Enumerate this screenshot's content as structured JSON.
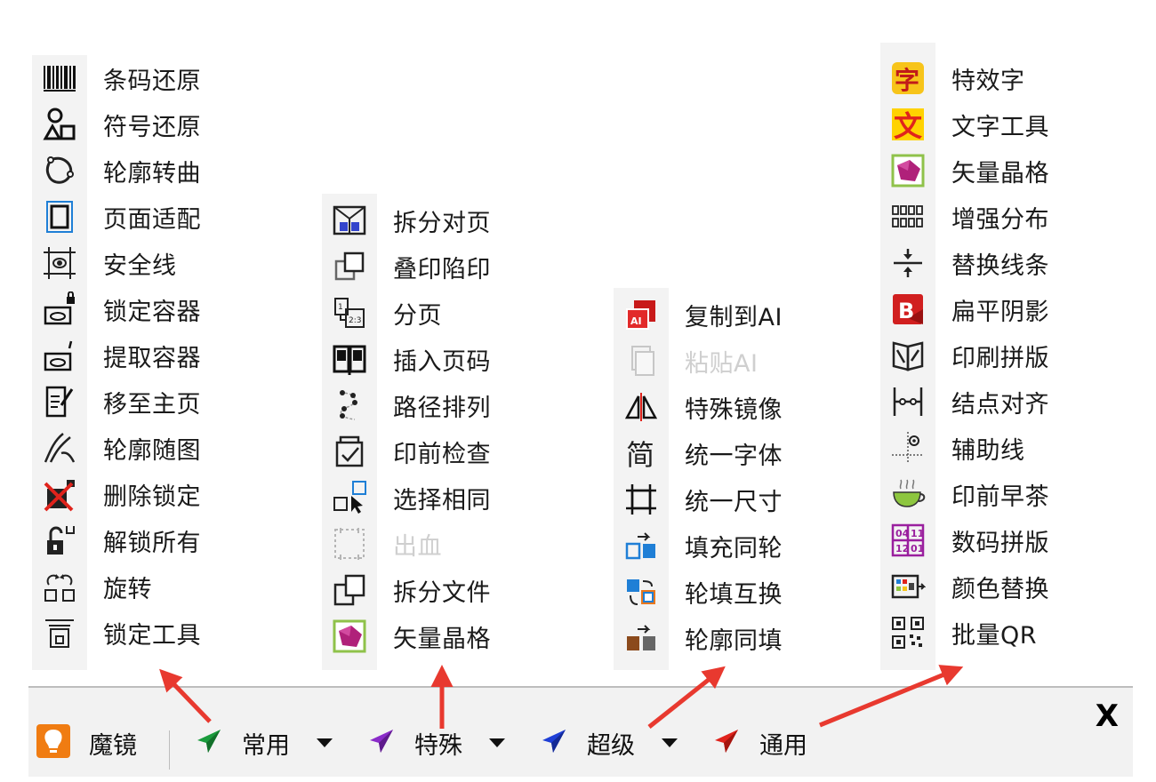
{
  "menus": {
    "common": {
      "items": [
        {
          "label": "条码还原",
          "icon": "barcode-icon"
        },
        {
          "label": "符号还原",
          "icon": "shapes-icon"
        },
        {
          "label": "轮廓转曲",
          "icon": "curve-outline-icon"
        },
        {
          "label": "页面适配",
          "icon": "page-fit-icon"
        },
        {
          "label": "安全线",
          "icon": "safety-line-icon"
        },
        {
          "label": "锁定容器",
          "icon": "lock-container-icon"
        },
        {
          "label": "提取容器",
          "icon": "extract-container-icon"
        },
        {
          "label": "移至主页",
          "icon": "move-to-master-icon"
        },
        {
          "label": "轮廓随图",
          "icon": "contour-follow-icon"
        },
        {
          "label": "删除锁定",
          "icon": "delete-lock-icon"
        },
        {
          "label": "解锁所有",
          "icon": "unlock-all-icon"
        },
        {
          "label": "旋转",
          "icon": "rotate-icon"
        },
        {
          "label": "锁定工具",
          "icon": "lock-tool-icon"
        }
      ]
    },
    "special": {
      "items": [
        {
          "label": "拆分对页",
          "icon": "split-spread-icon"
        },
        {
          "label": "叠印陷印",
          "icon": "overprint-trap-icon"
        },
        {
          "label": "分页",
          "icon": "paginate-icon"
        },
        {
          "label": "插入页码",
          "icon": "insert-page-number-icon"
        },
        {
          "label": "路径排列",
          "icon": "path-arrange-icon"
        },
        {
          "label": "印前检查",
          "icon": "preflight-icon"
        },
        {
          "label": "选择相同",
          "icon": "select-same-icon"
        },
        {
          "label": "出血",
          "icon": "bleed-icon",
          "disabled": true
        },
        {
          "label": "拆分文件",
          "icon": "split-file-icon"
        },
        {
          "label": "矢量晶格",
          "icon": "vector-crystal-icon"
        }
      ]
    },
    "super": {
      "items": [
        {
          "label": "复制到AI",
          "icon": "copy-to-ai-icon"
        },
        {
          "label": "粘贴AI",
          "icon": "paste-ai-icon",
          "disabled": true
        },
        {
          "label": "特殊镜像",
          "icon": "special-mirror-icon"
        },
        {
          "label": "统一字体",
          "icon": "unify-font-icon"
        },
        {
          "label": "统一尺寸",
          "icon": "unify-size-icon"
        },
        {
          "label": "填充同轮",
          "icon": "fill-same-outline-icon"
        },
        {
          "label": "轮填互换",
          "icon": "swap-fill-outline-icon"
        },
        {
          "label": "轮廓同填",
          "icon": "outline-same-fill-icon"
        }
      ]
    },
    "general": {
      "items": [
        {
          "label": "特效字",
          "icon": "effect-text-icon"
        },
        {
          "label": "文字工具",
          "icon": "text-tool-icon"
        },
        {
          "label": "矢量晶格",
          "icon": "vector-crystal-icon"
        },
        {
          "label": "增强分布",
          "icon": "enhanced-distribute-icon"
        },
        {
          "label": "替换线条",
          "icon": "replace-lines-icon"
        },
        {
          "label": "扁平阴影",
          "icon": "flat-shadow-icon"
        },
        {
          "label": "印刷拼版",
          "icon": "imposition-icon"
        },
        {
          "label": "结点对齐",
          "icon": "node-align-icon"
        },
        {
          "label": "辅助线",
          "icon": "guide-line-icon"
        },
        {
          "label": "印前早茶",
          "icon": "tea-cup-icon"
        },
        {
          "label": "数码拼版",
          "icon": "digital-imposition-icon"
        },
        {
          "label": "颜色替换",
          "icon": "color-replace-icon"
        },
        {
          "label": "批量QR",
          "icon": "batch-qr-icon"
        }
      ]
    }
  },
  "toolbar": {
    "app_label": "魔镜",
    "buttons": [
      {
        "label": "常用",
        "icon": "green-plane-icon",
        "color": "#1a9b3c",
        "has_dropdown": true
      },
      {
        "label": "特殊",
        "icon": "purple-plane-icon",
        "color": "#8a2bc9",
        "has_dropdown": true
      },
      {
        "label": "超级",
        "icon": "blue-plane-icon",
        "color": "#1f3fd6",
        "has_dropdown": true
      },
      {
        "label": "通用",
        "icon": "red-plane-icon",
        "color": "#e0231c",
        "has_dropdown": false
      }
    ],
    "close_label": "X"
  },
  "colors": {
    "annotation_arrow": "#e8392f",
    "brand_orange": "#f07c12"
  }
}
